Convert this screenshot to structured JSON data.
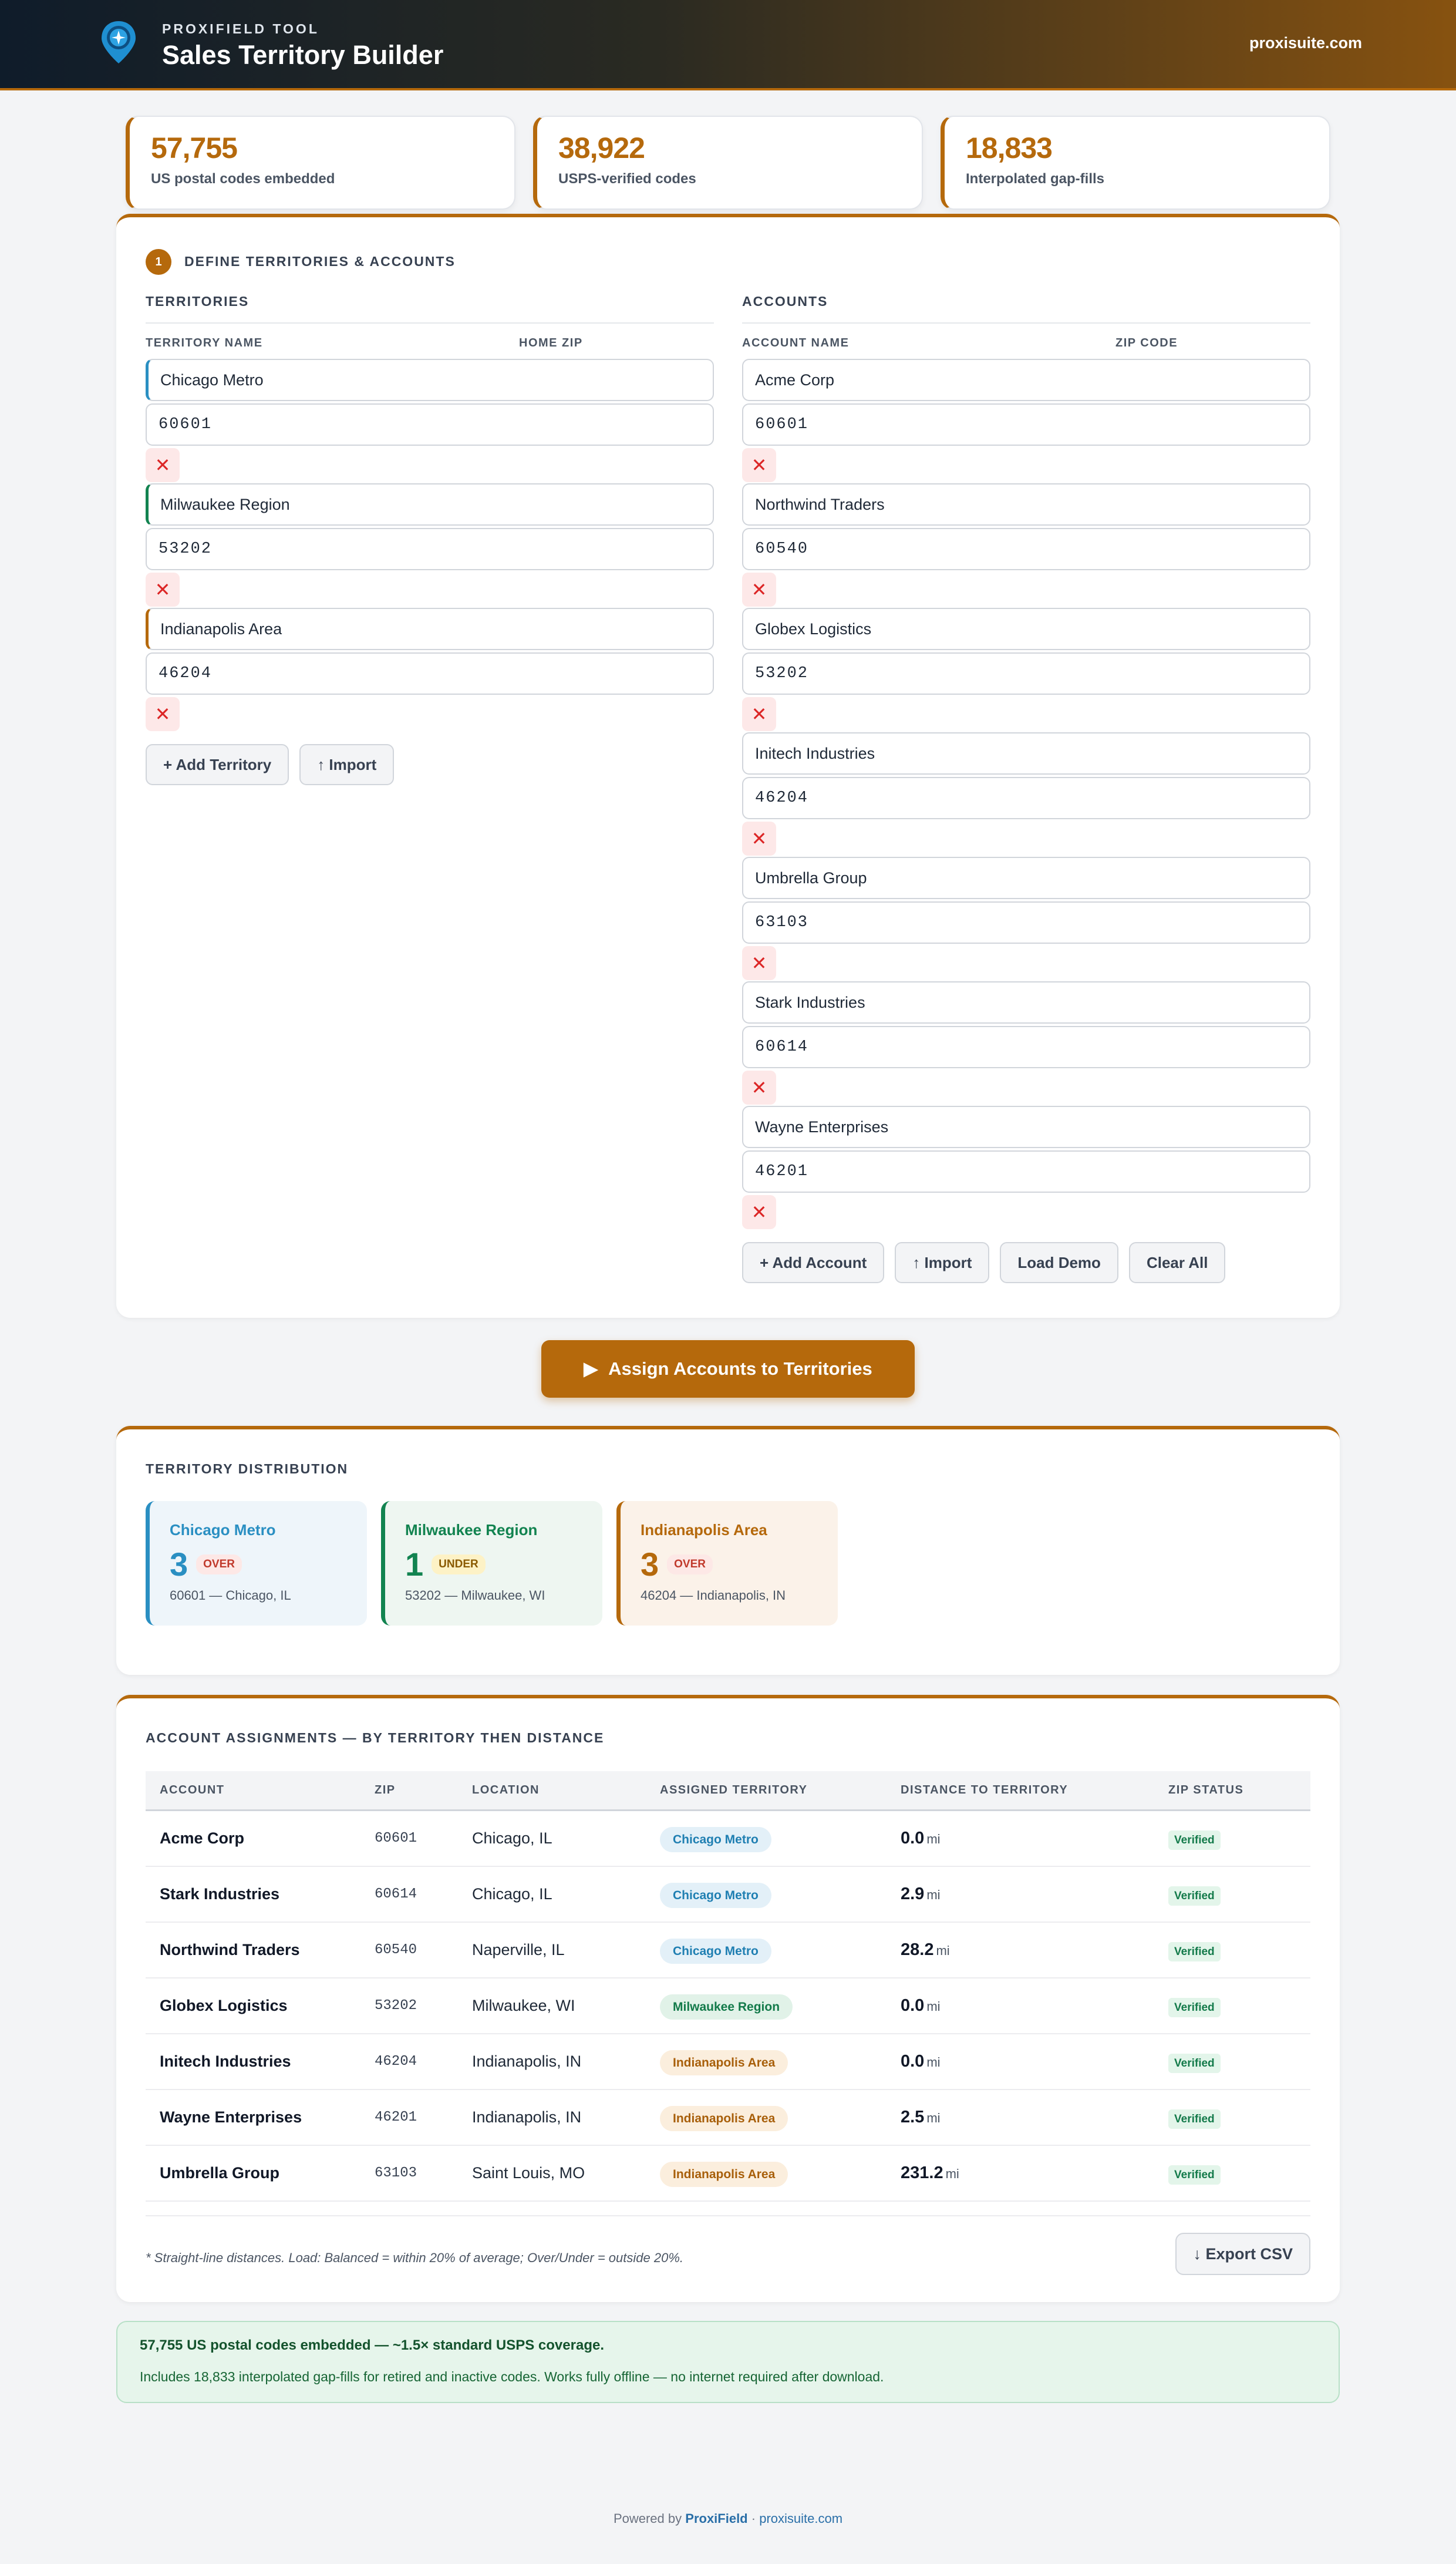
{
  "header": {
    "kicker": "PROXIFIELD TOOL",
    "title": "Sales Territory Builder",
    "site_link": "proxisuite.com"
  },
  "stats": [
    {
      "value": "57,755",
      "label": "US postal codes embedded"
    },
    {
      "value": "38,922",
      "label": "USPS-verified codes"
    },
    {
      "value": "18,833",
      "label": "Interpolated gap-fills"
    }
  ],
  "define": {
    "step": "1",
    "title": "DEFINE TERRITORIES & ACCOUNTS",
    "territories": {
      "heading": "TERRITORIES",
      "col_name": "TERRITORY NAME",
      "col_zip": "HOME ZIP",
      "rows": [
        {
          "name": "Chicago Metro",
          "zip": "60601",
          "color": "#2a8fc2"
        },
        {
          "name": "Milwaukee Region",
          "zip": "53202",
          "color": "#128350"
        },
        {
          "name": "Indianapolis Area",
          "zip": "46204",
          "color": "#b5690c"
        }
      ],
      "add_label": "+ Add Territory",
      "import_label": "↑ Import"
    },
    "accounts": {
      "heading": "ACCOUNTS",
      "col_name": "ACCOUNT NAME",
      "col_zip": "ZIP CODE",
      "rows": [
        {
          "name": "Acme Corp",
          "zip": "60601"
        },
        {
          "name": "Northwind Traders",
          "zip": "60540"
        },
        {
          "name": "Globex Logistics",
          "zip": "53202"
        },
        {
          "name": "Initech Industries",
          "zip": "46204"
        },
        {
          "name": "Umbrella Group",
          "zip": "63103"
        },
        {
          "name": "Stark Industries",
          "zip": "60614"
        },
        {
          "name": "Wayne Enterprises",
          "zip": "46201"
        }
      ],
      "add_label": "+ Add Account",
      "import_label": "↑ Import",
      "demo_label": "Load Demo",
      "clear_label": "Clear All"
    },
    "remove_glyph": "✕"
  },
  "assign_button": {
    "icon": "▶",
    "label": "Assign Accounts to Territories"
  },
  "distribution": {
    "title": "TERRITORY DISTRIBUTION",
    "cards": [
      {
        "name": "Chicago Metro",
        "count": "3",
        "load": "OVER",
        "sub": "60601 — Chicago, IL",
        "color": "#2a8fc2",
        "bg": "#eef5fa",
        "tag_color": "#c0392b",
        "tag_bg": "#fde8e6"
      },
      {
        "name": "Milwaukee Region",
        "count": "1",
        "load": "UNDER",
        "sub": "53202 — Milwaukee, WI",
        "color": "#128350",
        "bg": "#eef6f1",
        "tag_color": "#8a5a00",
        "tag_bg": "#fdf2c6"
      },
      {
        "name": "Indianapolis Area",
        "count": "3",
        "load": "OVER",
        "sub": "46204 — Indianapolis, IN",
        "color": "#b5690c",
        "bg": "#fbf2e9",
        "tag_color": "#c0392b",
        "tag_bg": "#fde8e6"
      }
    ]
  },
  "assignments": {
    "title": "ACCOUNT ASSIGNMENTS — BY TERRITORY THEN DISTANCE",
    "columns": [
      "ACCOUNT",
      "ZIP",
      "LOCATION",
      "ASSIGNED TERRITORY",
      "DISTANCE TO TERRITORY",
      "ZIP STATUS"
    ],
    "rows": [
      {
        "account": "Acme Corp",
        "zip": "60601",
        "location": "Chicago, IL",
        "territory": "Chicago Metro",
        "distance": "0.0",
        "status": "Verified"
      },
      {
        "account": "Stark Industries",
        "zip": "60614",
        "location": "Chicago, IL",
        "territory": "Chicago Metro",
        "distance": "2.9",
        "status": "Verified"
      },
      {
        "account": "Northwind Traders",
        "zip": "60540",
        "location": "Naperville, IL",
        "territory": "Chicago Metro",
        "distance": "28.2",
        "status": "Verified"
      },
      {
        "account": "Globex Logistics",
        "zip": "53202",
        "location": "Milwaukee, WI",
        "territory": "Milwaukee Region",
        "distance": "0.0",
        "status": "Verified"
      },
      {
        "account": "Initech Industries",
        "zip": "46204",
        "location": "Indianapolis, IN",
        "territory": "Indianapolis Area",
        "distance": "0.0",
        "status": "Verified"
      },
      {
        "account": "Wayne Enterprises",
        "zip": "46201",
        "location": "Indianapolis, IN",
        "territory": "Indianapolis Area",
        "distance": "2.5",
        "status": "Verified"
      },
      {
        "account": "Umbrella Group",
        "zip": "63103",
        "location": "Saint Louis, MO",
        "territory": "Indianapolis Area",
        "distance": "231.2",
        "status": "Verified"
      }
    ],
    "distance_unit": "mi",
    "territory_colors": {
      "Chicago Metro": {
        "fg": "#1f7fb2",
        "bg": "#e3f0f8"
      },
      "Milwaukee Region": {
        "fg": "#137a4a",
        "bg": "#e1f2e8"
      },
      "Indianapolis Area": {
        "fg": "#a85f0a",
        "bg": "#fbeedd"
      }
    },
    "note": "* Straight-line distances. Load: Balanced = within 20% of average; Over/Under = outside 20%.",
    "export_label": "↓ Export CSV"
  },
  "info": {
    "title": "57,755 US postal codes embedded — ~1.5× standard USPS coverage.",
    "text": "Includes 18,833 interpolated gap-fills for retired and inactive codes. Works fully offline — no internet required after download."
  },
  "footer": {
    "prefix": "Powered by",
    "brand": "ProxiField",
    "sep": "·",
    "site": "proxisuite.com"
  }
}
